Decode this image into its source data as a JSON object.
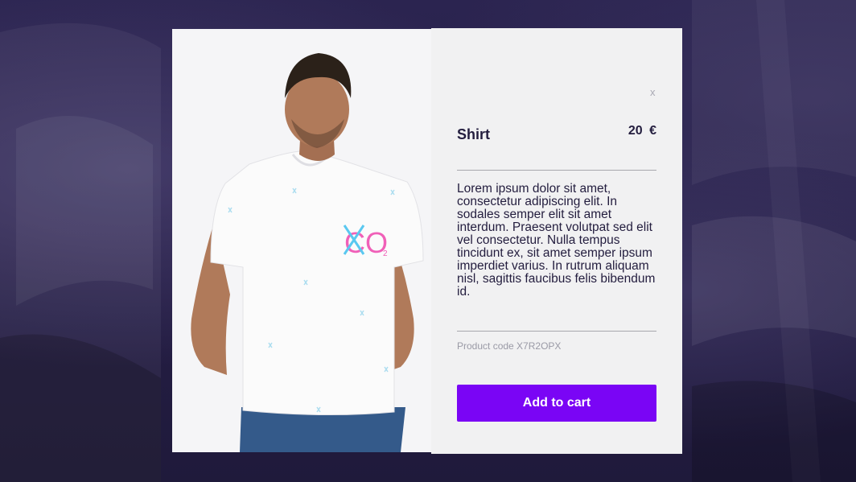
{
  "product": {
    "name": "Shirt",
    "price": "20 €",
    "description": "Lorem ipsum dolor sit amet, consectetur adipiscing elit. In sodales semper elit sit amet interdum. Praesent volutpat sed elit vel consectetur. Nulla tempus tincidunt ex, sit amet semper ipsum imperdiet varius. In rutrum aliquam nisl, sagittis faucibus felis bibendum id.",
    "code_label": "Product code X7R2OPX",
    "print_text": "CO",
    "print_subscript": "2"
  },
  "modal": {
    "close_label": "x",
    "cta_label": "Add to cart"
  },
  "colors": {
    "accent": "#7a05f5",
    "backdrop": "#2b2450",
    "panel": "#f1f1f2",
    "text": "#231d3e",
    "print_pink": "#f060b8",
    "print_blue": "#5ac8f0"
  },
  "icons": {
    "close": "close-icon"
  }
}
